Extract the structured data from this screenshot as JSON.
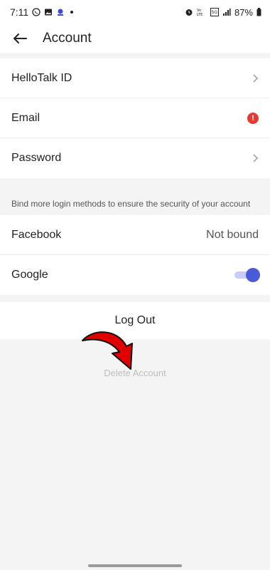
{
  "status_bar": {
    "time": "7:11",
    "battery": "87%",
    "icons": [
      "whatsapp-icon",
      "image-icon",
      "app-icon",
      "alarm-icon",
      "volte-icon",
      "5g-icon",
      "signal-icon",
      "battery-icon"
    ]
  },
  "header": {
    "title": "Account",
    "back_icon": "back-arrow-icon"
  },
  "account_items": [
    {
      "label": "HelloTalk ID",
      "indicator": "chevron-right-icon"
    },
    {
      "label": "Email",
      "indicator": "alert-icon",
      "alert_text": "!"
    },
    {
      "label": "Password",
      "indicator": "chevron-right-icon"
    }
  ],
  "bind_hint": "Bind more login methods to ensure the security of your account",
  "login_methods": [
    {
      "label": "Facebook",
      "value": "Not bound"
    },
    {
      "label": "Google",
      "toggle": true
    }
  ],
  "logout_label": "Log Out",
  "delete_label": "Delete Account",
  "colors": {
    "alert": "#e53935",
    "toggle_on": "#4b5bd8",
    "annotation_arrow": "#e00000"
  }
}
